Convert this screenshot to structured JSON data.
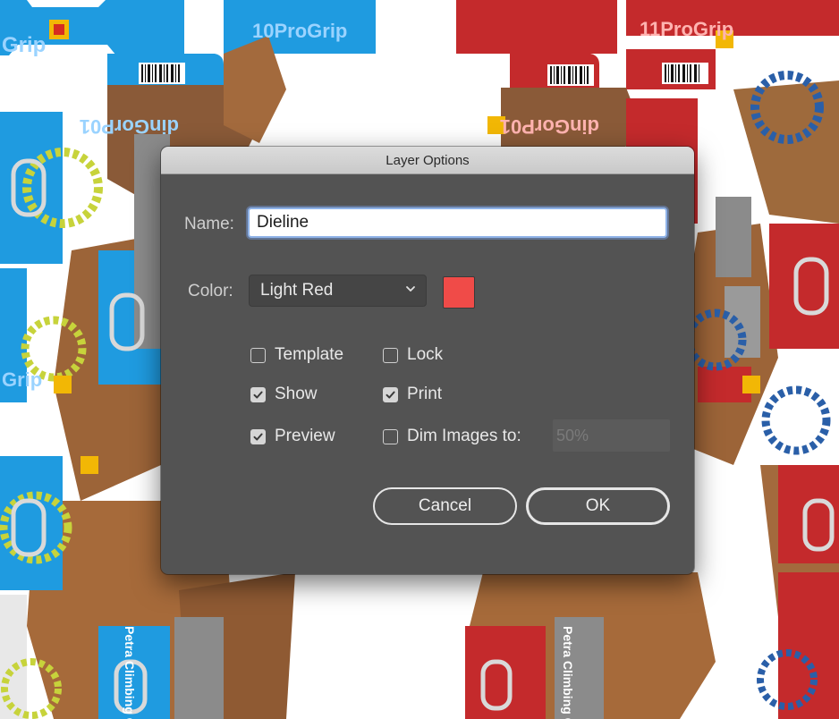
{
  "dialog": {
    "title": "Layer Options",
    "name_label": "Name:",
    "name_value": "Dieline",
    "color_label": "Color:",
    "color_value": "Light Red",
    "color_swatch": "#f04b48",
    "options": {
      "template": {
        "label": "Template",
        "checked": false
      },
      "lock": {
        "label": "Lock",
        "checked": false
      },
      "show": {
        "label": "Show",
        "checked": true
      },
      "print": {
        "label": "Print",
        "checked": true
      },
      "preview": {
        "label": "Preview",
        "checked": true
      },
      "dim_images": {
        "label": "Dim Images to:",
        "checked": false,
        "value": "50%"
      }
    },
    "cancel_label": "Cancel",
    "ok_label": "OK"
  },
  "background": {
    "brand_blue": "10ProGrip",
    "brand_red": "11ProGrip",
    "brand_short": "Grip",
    "brand_flipped": "dinGorP01",
    "company": "Petra Climbing Co",
    "blue_color": "#1f9be0",
    "red_color": "#c42a2c"
  }
}
